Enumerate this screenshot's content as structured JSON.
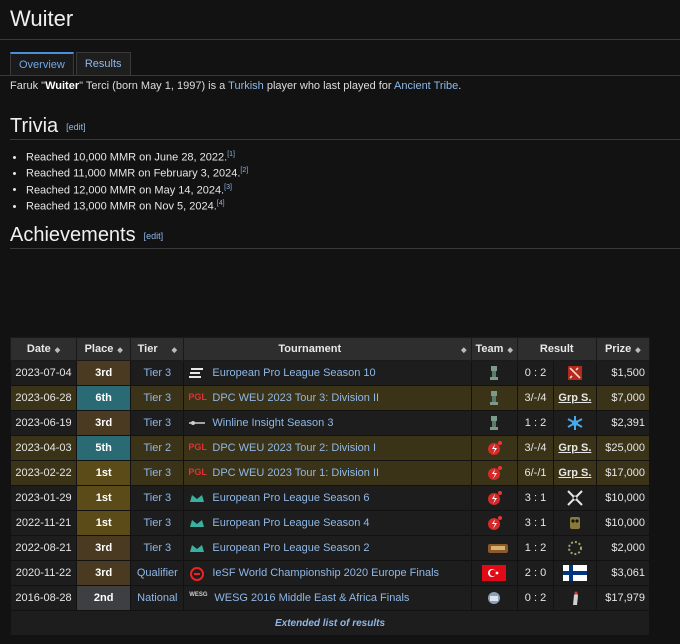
{
  "page": {
    "title": "Wuiter"
  },
  "tabs": [
    {
      "label": "Overview",
      "active": true
    },
    {
      "label": "Results",
      "active": false
    }
  ],
  "intro": {
    "p1": "Faruk \"",
    "nick": "Wuiter",
    "p2": "\" Terci (born May 1, 1997) is a ",
    "nationality": "Turkish",
    "p3": " player who last played for ",
    "team": "Ancient Tribe",
    "p4": "."
  },
  "trivia": {
    "title": "Trivia",
    "edit": "[edit]",
    "items": [
      {
        "text": "Reached 10,000 MMR on June 28, 2022.",
        "ref": "[1]"
      },
      {
        "text": "Reached 11,000 MMR on February 3, 2024.",
        "ref": "[2]"
      },
      {
        "text": "Reached 12,000 MMR on May 14, 2024.",
        "ref": "[3]"
      },
      {
        "text": "Reached 13,000 MMR on Nov 5, 2024.",
        "ref": "[4]"
      }
    ]
  },
  "achievements": {
    "title": "Achievements",
    "edit": "edit",
    "columns": {
      "date": "Date",
      "place": "Place",
      "tier": "Tier",
      "tournament": "Tournament",
      "team": "Team",
      "result": "Result",
      "prize": "Prize"
    },
    "rows": [
      {
        "date": "2023-07-04",
        "place": "3rd",
        "tier": "Tier 3",
        "tournament": "European Pro League Season 10",
        "score": "0 : 2",
        "opponent": "",
        "prize": "$1,500"
      },
      {
        "date": "2023-06-28",
        "place": "6th",
        "tier": "Tier 3",
        "tournament": "DPC WEU 2023 Tour 3: Division II",
        "score": "3/-/4",
        "opponent": "Grp S.",
        "prize": "$7,000"
      },
      {
        "date": "2023-06-19",
        "place": "3rd",
        "tier": "Tier 3",
        "tournament": "Winline Insight Season 3",
        "score": "1 : 2",
        "opponent": "",
        "prize": "$2,391"
      },
      {
        "date": "2023-04-03",
        "place": "5th",
        "tier": "Tier 2",
        "tournament": "DPC WEU 2023 Tour 2: Division I",
        "score": "3/-/4",
        "opponent": "Grp S.",
        "prize": "$25,000"
      },
      {
        "date": "2023-02-22",
        "place": "1st",
        "tier": "Tier 3",
        "tournament": "DPC WEU 2023 Tour 1: Division II",
        "score": "6/-/1",
        "opponent": "Grp S.",
        "prize": "$17,000"
      },
      {
        "date": "2023-01-29",
        "place": "1st",
        "tier": "Tier 3",
        "tournament": "European Pro League Season 6",
        "score": "3 : 1",
        "opponent": "",
        "prize": "$10,000"
      },
      {
        "date": "2022-11-21",
        "place": "1st",
        "tier": "Tier 3",
        "tournament": "European Pro League Season 4",
        "score": "3 : 1",
        "opponent": "",
        "prize": "$10,000"
      },
      {
        "date": "2022-08-21",
        "place": "3rd",
        "tier": "Tier 3",
        "tournament": "European Pro League Season 2",
        "score": "1 : 2",
        "opponent": "",
        "prize": "$2,000"
      },
      {
        "date": "2020-11-22",
        "place": "3rd",
        "tier": "Qualifier",
        "tournament": "IeSF World Championship 2020 Europe Finals",
        "score": "2 : 0",
        "opponent": "",
        "prize": "$3,061"
      },
      {
        "date": "2016-08-28",
        "place": "2nd",
        "tier": "National",
        "tournament": "WESG 2016 Middle East & Africa Finals",
        "score": "0 : 2",
        "opponent": "",
        "prize": "$17,979"
      }
    ],
    "footer": "Extended list of results"
  },
  "icons": {
    "pgl": "PGL",
    "wesg": "WESG"
  },
  "colors": {
    "link": "#8fb8e8",
    "first": "#5b4b19",
    "second": "#3d3f43",
    "third": "#4a3a22",
    "fifth_sixth": "#2a6a74"
  }
}
